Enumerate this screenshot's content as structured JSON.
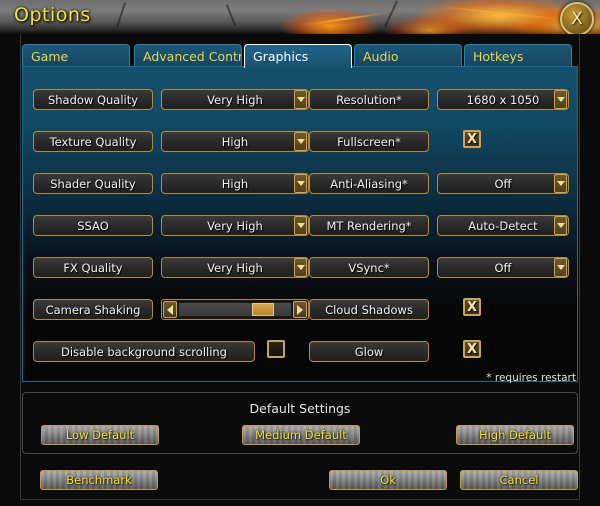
{
  "window": {
    "title": "Options",
    "close_label": "X",
    "close_icon": "close-icon"
  },
  "tabs": [
    {
      "label": "Game",
      "active": false
    },
    {
      "label": "Advanced Controls",
      "active": false
    },
    {
      "label": "Graphics",
      "active": true
    },
    {
      "label": "Audio",
      "active": false
    },
    {
      "label": "Hotkeys",
      "active": false
    }
  ],
  "settings_left": [
    {
      "label": "Shadow Quality",
      "type": "dropdown",
      "value": "Very High"
    },
    {
      "label": "Texture Quality",
      "type": "dropdown",
      "value": "High"
    },
    {
      "label": "Shader Quality",
      "type": "dropdown",
      "value": "High"
    },
    {
      "label": "SSAO",
      "type": "dropdown",
      "value": "Very High"
    },
    {
      "label": "FX Quality",
      "type": "dropdown",
      "value": "Very High"
    },
    {
      "label": "Camera Shaking",
      "type": "slider",
      "value": 85
    },
    {
      "label": "Disable background scrolling",
      "type": "checkbox",
      "checked": false
    }
  ],
  "settings_right": [
    {
      "label": "Resolution*",
      "type": "dropdown",
      "value": "1680 x 1050"
    },
    {
      "label": "Fullscreen*",
      "type": "checkbox",
      "checked": true
    },
    {
      "label": "Anti-Aliasing*",
      "type": "dropdown",
      "value": "Off"
    },
    {
      "label": "MT Rendering*",
      "type": "dropdown",
      "value": "Auto-Detect"
    },
    {
      "label": "VSync*",
      "type": "dropdown",
      "value": "Off"
    },
    {
      "label": "Cloud Shadows",
      "type": "checkbox",
      "checked": true
    },
    {
      "label": "Glow",
      "type": "checkbox",
      "checked": true
    }
  ],
  "restart_note": "* requires restart",
  "checkbox_mark": "X",
  "defaults": {
    "title": "Default Settings",
    "low": "Low Default",
    "medium": "Medium Default",
    "high": "High Default"
  },
  "actions": {
    "benchmark": "Benchmark",
    "ok": "Ok",
    "cancel": "Cancel"
  },
  "colors": {
    "accent_gold": "#c8a558",
    "title_yellow": "#f2e23a",
    "tab_blue": "#1d5878",
    "active_tab_text": "#ffffff"
  }
}
